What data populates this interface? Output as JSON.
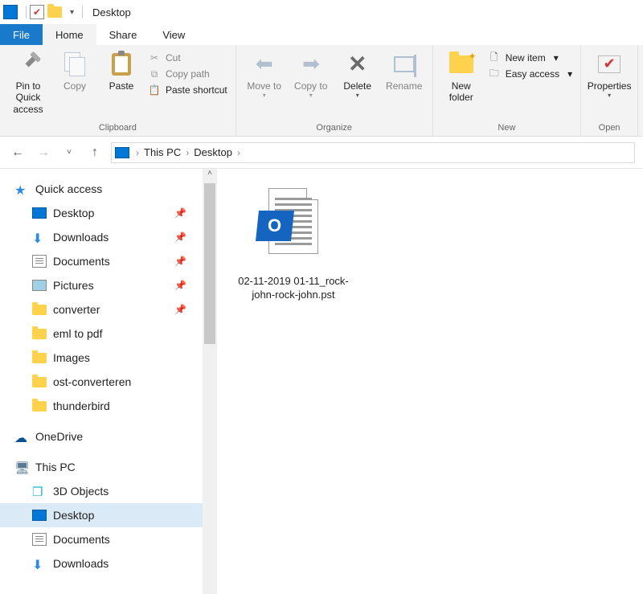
{
  "title": "Desktop",
  "tabs": {
    "file": "File",
    "home": "Home",
    "share": "Share",
    "view": "View"
  },
  "ribbon": {
    "clipboard": {
      "label": "Clipboard",
      "pin": "Pin to Quick access",
      "copy": "Copy",
      "paste": "Paste",
      "cut": "Cut",
      "copypath": "Copy path",
      "pasteshortcut": "Paste shortcut"
    },
    "organize": {
      "label": "Organize",
      "moveto": "Move to",
      "copyto": "Copy to",
      "delete": "Delete",
      "rename": "Rename"
    },
    "new": {
      "label": "New",
      "newfolder": "New folder",
      "newitem": "New item",
      "easyaccess": "Easy access"
    },
    "open": {
      "label": "Open",
      "properties": "Properties"
    }
  },
  "breadcrumb": {
    "root": "This PC",
    "current": "Desktop"
  },
  "nav": {
    "quick": "Quick access",
    "desktop": "Desktop",
    "downloads": "Downloads",
    "documents": "Documents",
    "pictures": "Pictures",
    "converter": "converter",
    "emltopdf": "eml to pdf",
    "images": "Images",
    "ostconv": "ost-converteren",
    "thunderbird": "thunderbird",
    "onedrive": "OneDrive",
    "thispc": "This PC",
    "3dobjects": "3D Objects",
    "desktop2": "Desktop",
    "documents2": "Documents",
    "downloads2": "Downloads"
  },
  "file": {
    "name": "02-11-2019 01-11_rock-john-rock-john.pst",
    "badge": "O"
  }
}
